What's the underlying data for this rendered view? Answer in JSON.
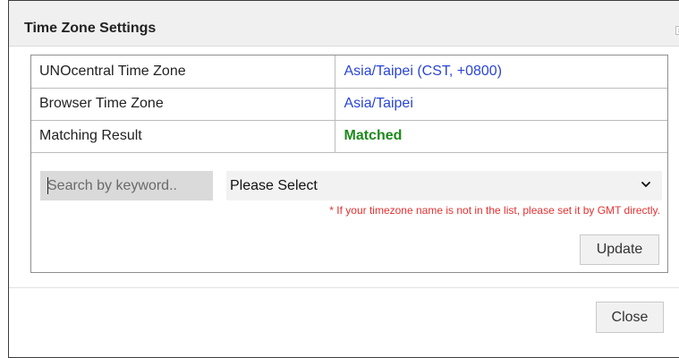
{
  "dialog": {
    "title": "Time Zone Settings",
    "header_close_glyph": "×"
  },
  "info_table": {
    "rows": [
      {
        "label": "UNOcentral Time Zone",
        "value": "Asia/Taipei (CST, +0800)"
      },
      {
        "label": "Browser Time Zone",
        "value": "Asia/Taipei"
      },
      {
        "label": "Matching Result",
        "value": "Matched"
      }
    ]
  },
  "search": {
    "placeholder": "Search by keyword..",
    "value": ""
  },
  "timezone_select": {
    "selected": "Please Select",
    "icon": "chevron-down-icon"
  },
  "hint": "* If your timezone name is not in the list, please set it by GMT directly.",
  "buttons": {
    "update": "Update",
    "close": "Close"
  },
  "colors": {
    "link_value": "#2a45d6",
    "matched": "#1d8a1d",
    "hint": "#e53030"
  }
}
